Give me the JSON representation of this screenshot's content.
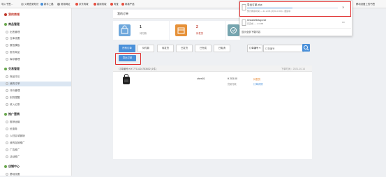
{
  "bookmarks": [
    "导入书签...",
    "火眼查到知识",
    "新手上路",
    "常用网址",
    "京东商城",
    "越狱改版",
    "淘宝",
    "网易严选"
  ],
  "top_right": "移动设备上的书签",
  "sidebar": {
    "header": "我的商城",
    "sections": [
      {
        "title": "商品管理",
        "items": [
          "出售管理",
          "仓库设置",
          "属性模板",
          "发布商品",
          "库存管理"
        ]
      },
      {
        "title": "交易管理",
        "items": [
          "商品评论",
          "我的订单",
          "评价管理",
          "到货提醒",
          "收入记录"
        ]
      },
      {
        "title": "推广营销",
        "items": [
          "推荐运输",
          "优惠券",
          "入驻区域营销",
          "我的促销推广",
          "广告推广",
          "活动推广"
        ]
      },
      {
        "title": "店铺中心",
        "items": [
          "基础设置"
        ]
      }
    ]
  },
  "page_title": "我的订单",
  "cards": [
    {
      "num": "1",
      "label": "待付款",
      "color": "#6fa8dc"
    },
    {
      "num": "2",
      "label": "待发货",
      "color": "#e69138"
    },
    {
      "num": "0",
      "label": "待收货",
      "color": "#76a5af"
    }
  ],
  "tabs": [
    "所有订单",
    "待付款",
    "待发货",
    "已发货",
    "已完成",
    "已取消",
    "所有订单"
  ],
  "search": {
    "select": "订单编号",
    "placeholder": "订单编号"
  },
  "export_button": "导出订单",
  "order": {
    "header": "订单编号:KH77713124783602 (1件)",
    "time": "下单时间：2021-10-14",
    "buyer": "chen01",
    "price": "¥ 203.00",
    "price_sub": "货到付款",
    "status": "待发货",
    "status_link": "订单详情"
  },
  "downloads": {
    "item1": {
      "name": "导出订单.xlsx",
      "meta": "预计剩余时间 — 41.2 KB (共 81.0 KB) - 继续中"
    },
    "item2": {
      "name": "ChromeSetup.exe",
      "meta": "已完成 — 1.3 MB"
    },
    "footer": "显示全部下载内容"
  }
}
